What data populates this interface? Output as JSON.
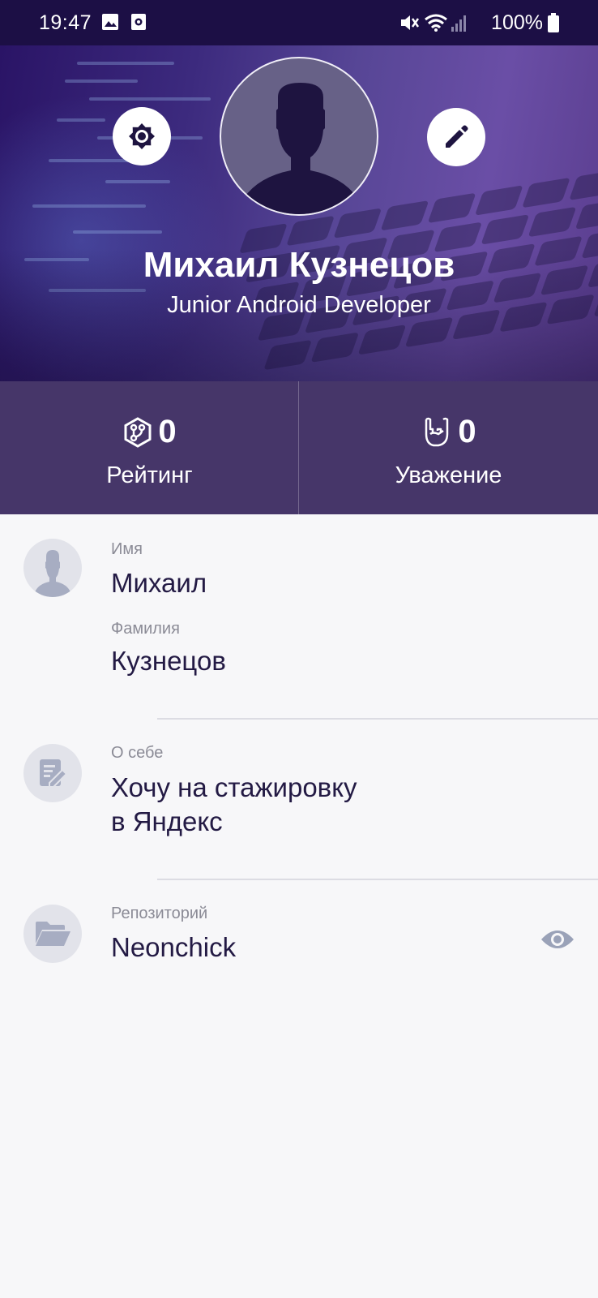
{
  "status_bar": {
    "time": "19:47",
    "battery": "100%",
    "icons": [
      "gallery-icon",
      "screen-record-icon",
      "mute-icon",
      "wifi-icon",
      "signal-icon",
      "battery-icon"
    ]
  },
  "header": {
    "name": "Михаил Кузнецов",
    "title": "Junior Android Developer",
    "settings_icon": "settings-icon",
    "edit_icon": "edit-pencil-icon"
  },
  "stats": {
    "rating": {
      "value": "0",
      "label": "Рейтинг",
      "icon": "rating-hexagon-icon"
    },
    "respect": {
      "value": "0",
      "label": "Уважение",
      "icon": "rock-hand-icon"
    }
  },
  "fields": {
    "first_name": {
      "label": "Имя",
      "value": "Михаил"
    },
    "last_name": {
      "label": "Фамилия",
      "value": "Кузнецов"
    },
    "about": {
      "label": "О себе",
      "value_line1": "Хочу на стажировку",
      "value_line2": "в Яндекс"
    },
    "repository": {
      "label": "Репозиторий",
      "value": "Neonchick"
    }
  },
  "colors": {
    "status_bar": "#1c0f45",
    "stats_background": "#463669",
    "text_primary": "#231a44",
    "text_secondary": "#8b8b96",
    "icon_gray": "#a7adc2"
  }
}
